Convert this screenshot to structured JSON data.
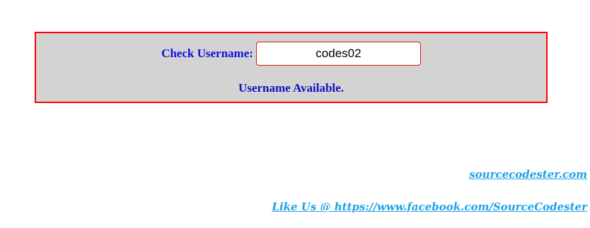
{
  "form": {
    "label": "Check Username:",
    "input_value": "codes02",
    "status": "Username Available."
  },
  "footer": {
    "site_link": "sourcecodester.com",
    "facebook_link": "Like Us @ https://www.facebook.com/SourceCodester"
  },
  "colors": {
    "panel_bg": "#d3d3d3",
    "panel_border": "#ff0000",
    "label_text": "#1010e0",
    "footer_link": "#1ea0e6"
  }
}
